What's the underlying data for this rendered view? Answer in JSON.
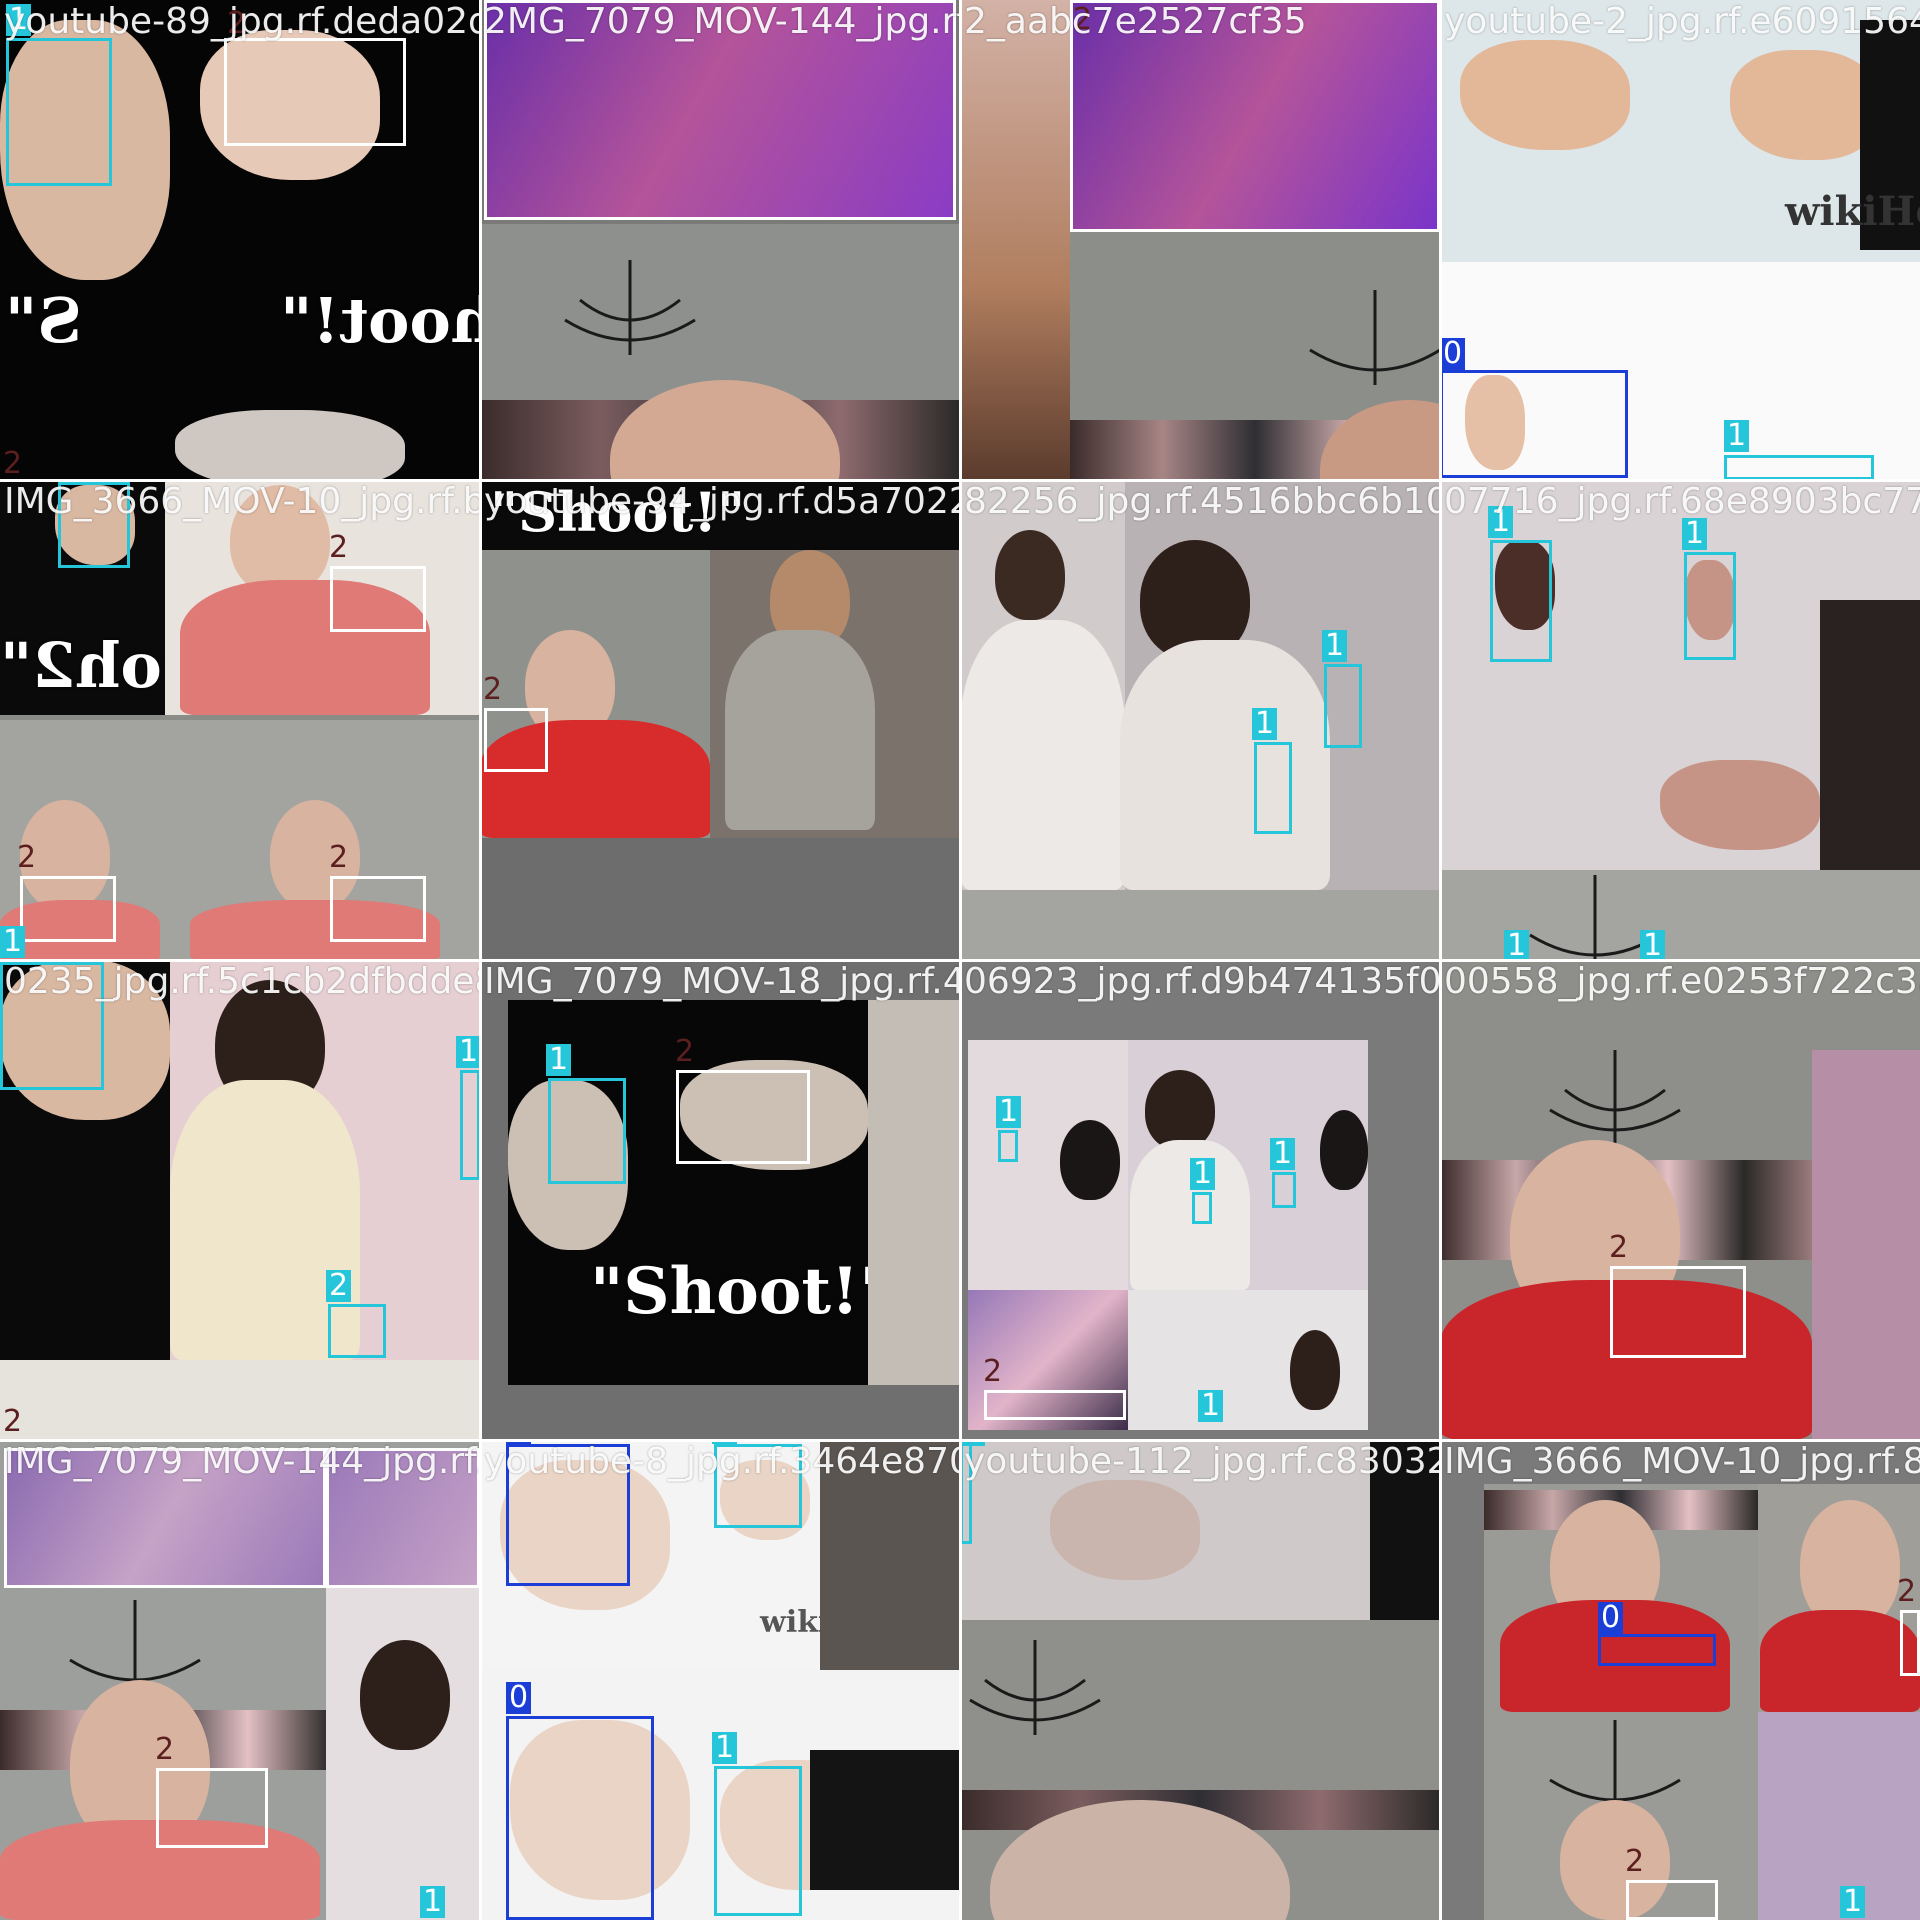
{
  "page": {
    "title": "Detection batch mosaic"
  },
  "classes": {
    "0": {
      "label": "0",
      "color": "#1b3fd6"
    },
    "1": {
      "label": "1",
      "color": "#26c6da"
    },
    "2": {
      "label": "2",
      "color": "#ffffff",
      "tag_color": "#5c1f1f"
    }
  },
  "tiles": [
    {
      "id": "r0c0",
      "title": "youtube-89_jpg.rf.deda02dc",
      "overlay": "\"Shoot!\"",
      "overlay2": "S\"",
      "labels": [
        "1",
        "2",
        "2"
      ]
    },
    {
      "id": "r0c1",
      "title": "2MG_7079_MOV-144_jpg.rf.9c3",
      "labels": []
    },
    {
      "id": "r0c2",
      "title": "2_aabc7e2527cf35",
      "labels": [
        "2"
      ]
    },
    {
      "id": "r0c3",
      "title": "youtube-2_jpg.rf.e6091564a",
      "wikihow": "wikiHow",
      "labels": [
        "0",
        "1"
      ]
    },
    {
      "id": "r1c0",
      "title": "IMG_3666_MOV-10_jpg.rf.b",
      "overlay": "oh2\"",
      "labels": [
        "1",
        "2",
        "2",
        "2",
        "1"
      ]
    },
    {
      "id": "r1c1",
      "title": "youtube-94_jpg.rf.d5a7022",
      "overlay": "\"Shoot!\"",
      "labels": [
        "2"
      ]
    },
    {
      "id": "r1c2",
      "title": "82256_jpg.rf.4516bbc6b100b5",
      "labels": [
        "1",
        "1"
      ]
    },
    {
      "id": "r1c3",
      "title": "07716_jpg.rf.68e8903bc77fa5",
      "labels": [
        "1",
        "1",
        "1",
        "1"
      ]
    },
    {
      "id": "r2c0",
      "title": "0235_jpg.rf.5c1cb2dfbdde8",
      "labels": [
        "1",
        "1",
        "2",
        "2"
      ]
    },
    {
      "id": "r2c1",
      "title": "IMG_7079_MOV-18_jpg.rf.4",
      "overlay": "\"Shoot!\"",
      "labels": [
        "1",
        "2"
      ]
    },
    {
      "id": "r2c2",
      "title": "06923_jpg.rf.d9b474135f0e94",
      "labels": [
        "1",
        "1",
        "1",
        "2",
        "1"
      ]
    },
    {
      "id": "r2c3",
      "title": "00558_jpg.rf.e0253f722c3a04",
      "labels": [
        "2"
      ]
    },
    {
      "id": "r3c0",
      "title": "IMG_7079_MOV-144_jpg.rf.",
      "labels": [
        "2",
        "1"
      ]
    },
    {
      "id": "r3c1",
      "title": "youtube-8_jpg.rf.3464e870",
      "wikihow": "wikiHow",
      "labels": [
        "0",
        "1",
        "0",
        "1"
      ]
    },
    {
      "id": "r3c2",
      "title": "youtube-112_jpg.rf.c83032a3",
      "labels": [
        "1"
      ]
    },
    {
      "id": "r3c3",
      "title": "IMG_3666_MOV-10_jpg.rf.8",
      "labels": [
        "0",
        "2",
        "2",
        "1"
      ]
    }
  ]
}
